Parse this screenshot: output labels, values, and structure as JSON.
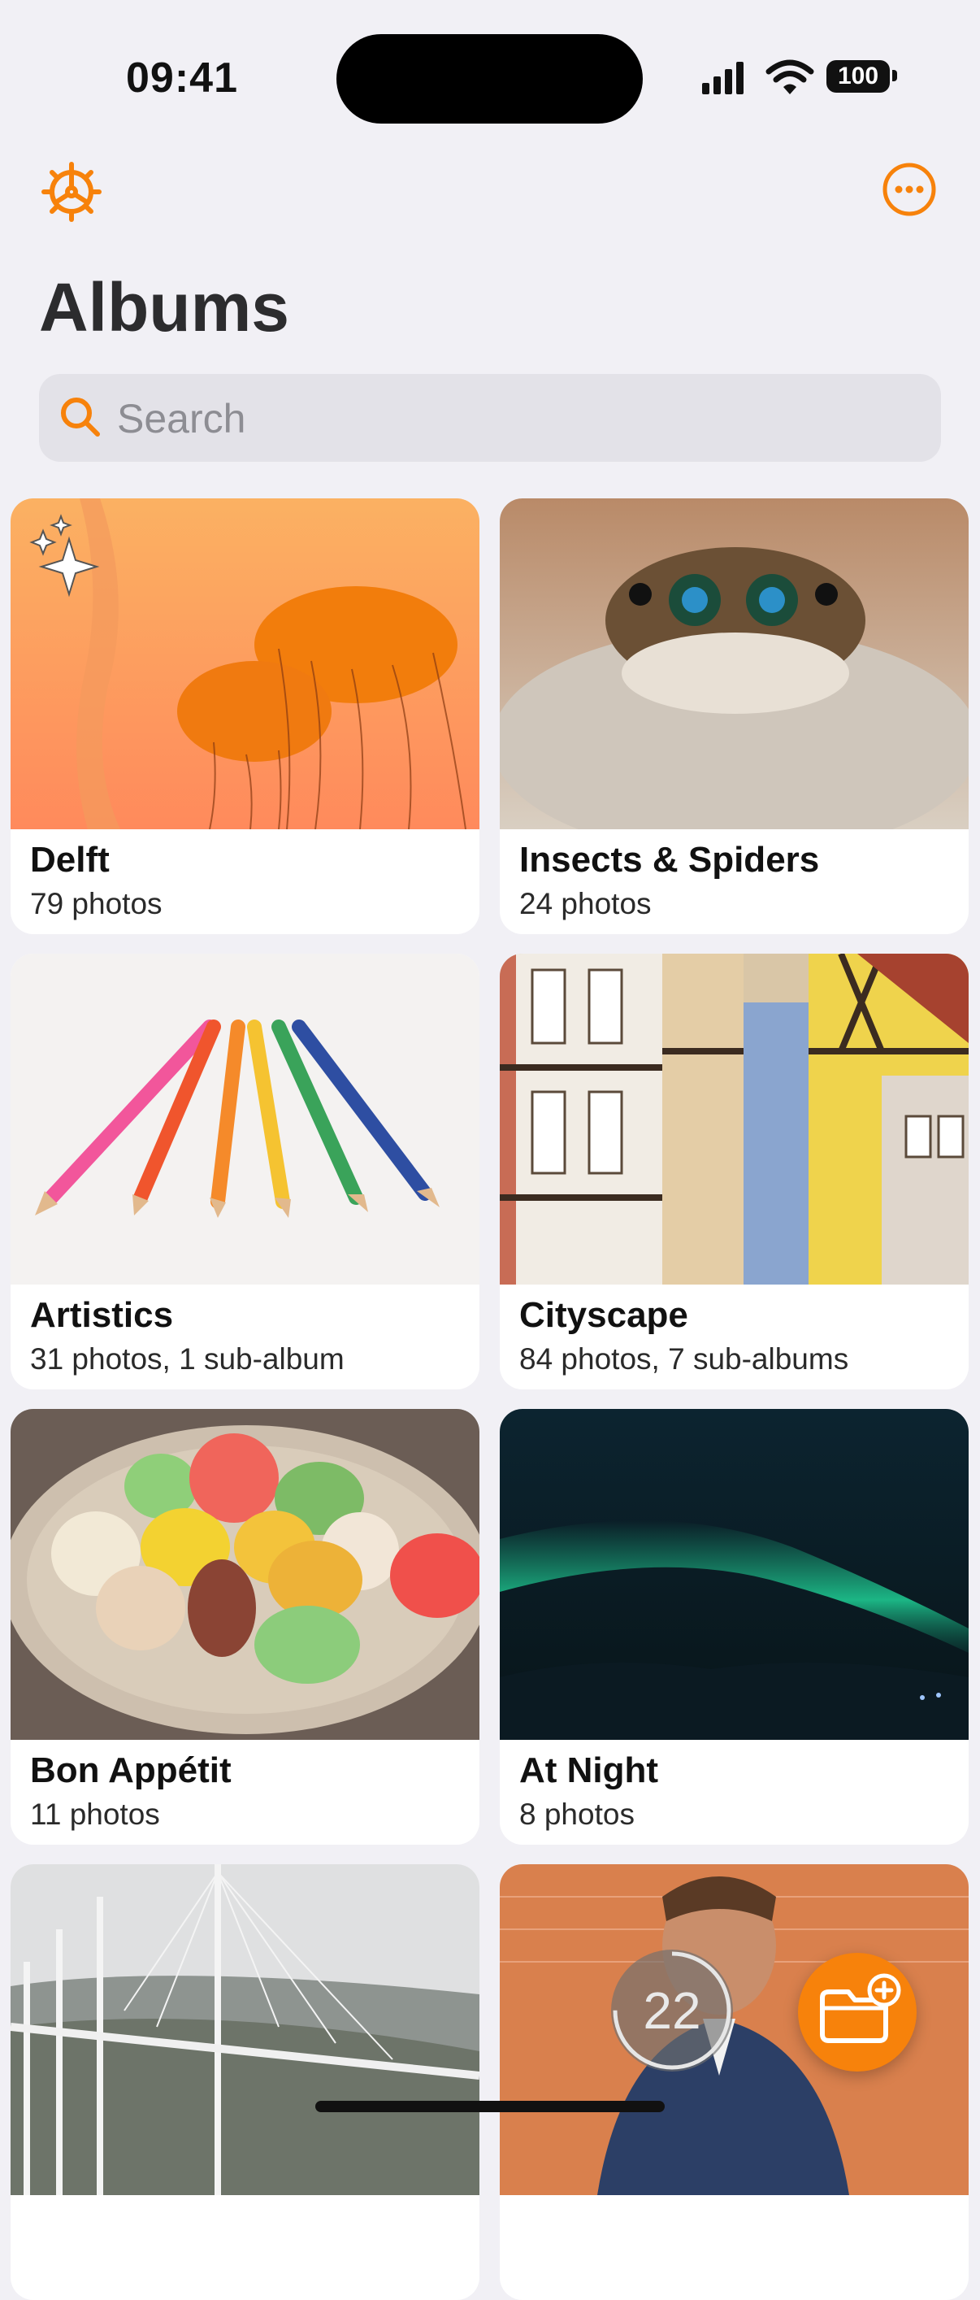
{
  "status": {
    "time": "09:41",
    "battery": "100"
  },
  "header": {
    "title": "Albums"
  },
  "search": {
    "placeholder": "Search"
  },
  "albums": [
    {
      "title": "Delft",
      "subtitle": "79 photos",
      "thumb": "jellyfish"
    },
    {
      "title": "Insects & Spiders",
      "subtitle": "24 photos",
      "thumb": "spider"
    },
    {
      "title": "Artistics",
      "subtitle": "31 photos, 1 sub-album",
      "thumb": "pencils"
    },
    {
      "title": "Cityscape",
      "subtitle": "84 photos, 7 sub-albums",
      "thumb": "houses"
    },
    {
      "title": "Bon Appétit",
      "subtitle": "11 photos",
      "thumb": "macarons"
    },
    {
      "title": "At Night",
      "subtitle": "8 photos",
      "thumb": "aurora"
    }
  ],
  "floating": {
    "counter": "22"
  },
  "colors": {
    "accent": "#f7820b",
    "background": "#f1f0f5"
  }
}
